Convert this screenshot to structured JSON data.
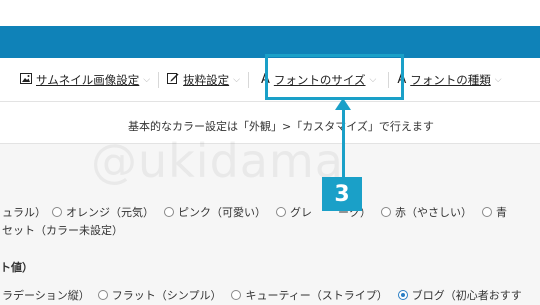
{
  "tabs": [
    {
      "label": "サムネイル画像設定",
      "icon": "image-icon"
    },
    {
      "label": "抜粋設定",
      "icon": "edit-icon"
    },
    {
      "label": "フォントのサイズ",
      "icon": "font-icon"
    },
    {
      "label": "フォントの種類",
      "icon": "font-icon"
    }
  ],
  "annotation": {
    "step": "3",
    "color": "#1aa0c8"
  },
  "note": "基本的なカラー設定は「外観」>「カスタマイズ」で行えます",
  "watermark": "@ukidama",
  "color_options": {
    "row1": [
      "ュラル）",
      "オレンジ（元気）",
      "ピンク（可愛い）",
      "グレ",
      "ーク）",
      "赤（やさしい）",
      "青"
    ],
    "row2": "セット（カラー未設定）"
  },
  "heading": "ト値）",
  "style_options": [
    "ラデーション縦）",
    "フラット（シンプル）",
    "キューティー（ストライプ）",
    "ブログ（初心者おすす"
  ],
  "selected_style": "ブログ（初心者おすす",
  "brand_color": "#0f82b8"
}
